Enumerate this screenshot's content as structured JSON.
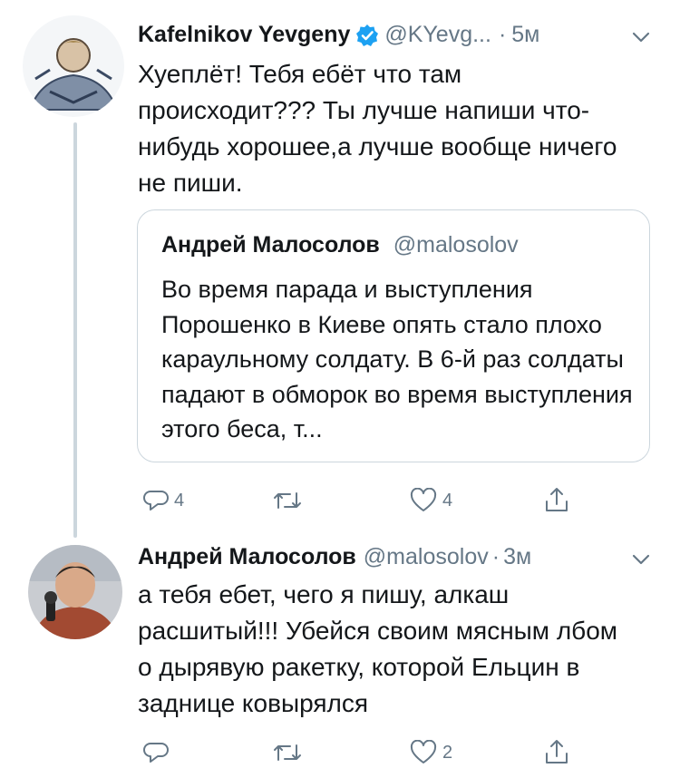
{
  "tweet1": {
    "author_name": "Kafelnikov Yevgeny",
    "handle": "@KYevg...",
    "time": "5м",
    "text": "Хуеплёт! Тебя ебёт что там происходит??? Ты лучше напиши что-нибудь хорошее,а лучше вообще ничего не пиши.",
    "quoted": {
      "author_name": "Андрей Малосолов",
      "handle": "@malosolov",
      "text": "Во время парада и выступления Порошенко в Киеве опять стало плохо караульному солдату. В 6-й раз солдаты падают в обморок во время выступления этого беса, т..."
    },
    "actions": {
      "reply_count": "4",
      "retweet_count": "",
      "like_count": "4"
    }
  },
  "tweet2": {
    "author_name": "Андрей Малосолов",
    "handle": "@malosolov",
    "time": "3м",
    "text": "а тебя ебет, чего я пишу, алкаш расшитый!!! Убейся своим мясным лбом о дырявую ракетку, которой Ельцин в заднице ковырялся",
    "actions": {
      "reply_count": "",
      "retweet_count": "",
      "like_count": "2"
    }
  },
  "colors": {
    "text": "#14171a",
    "secondary": "#657786",
    "verified": "#1da1f2",
    "border": "#ccd6dd"
  },
  "icons": [
    "verified-badge-icon",
    "chevron-down-icon",
    "reply-icon",
    "retweet-icon",
    "like-icon",
    "share-icon"
  ]
}
